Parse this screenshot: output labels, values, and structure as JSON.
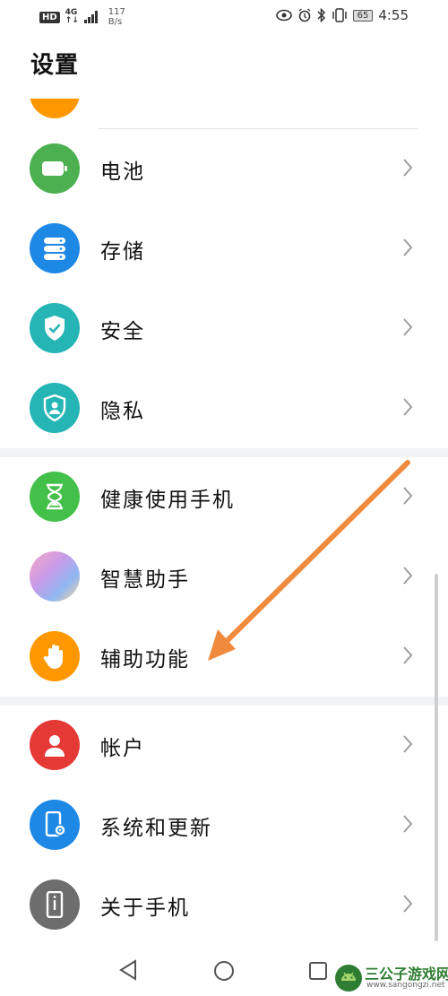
{
  "status_bar": {
    "hd": "HD",
    "network_top": "4G",
    "network_bottom": "↑↓",
    "speed_value": "117",
    "speed_unit": "B/s",
    "battery": "65",
    "time": "4:55"
  },
  "page_title": "设置",
  "items": [
    {
      "label": "电池",
      "icon": "battery-icon",
      "color": "#4caf50"
    },
    {
      "label": "存储",
      "icon": "storage-icon",
      "color": "#1e88e5"
    },
    {
      "label": "安全",
      "icon": "shield-check-icon",
      "color": "#26b5b5"
    },
    {
      "label": "隐私",
      "icon": "privacy-icon",
      "color": "#26b5b5"
    },
    {
      "label": "健康使用手机",
      "icon": "hourglass-icon",
      "color": "#43c04a"
    },
    {
      "label": "智慧助手",
      "icon": "assistant-icon",
      "color": "#c89be8"
    },
    {
      "label": "辅助功能",
      "icon": "hand-icon",
      "color": "#ff9800"
    },
    {
      "label": "帐户",
      "icon": "account-icon",
      "color": "#e53935"
    },
    {
      "label": "系统和更新",
      "icon": "phone-gear-icon",
      "color": "#1e88e5"
    },
    {
      "label": "关于手机",
      "icon": "phone-info-icon",
      "color": "#6d6d6d"
    }
  ],
  "annotation_arrow_color": "#f08a3c",
  "watermark": {
    "title": "三公子游戏网",
    "url": "www.sangongzi.net"
  }
}
